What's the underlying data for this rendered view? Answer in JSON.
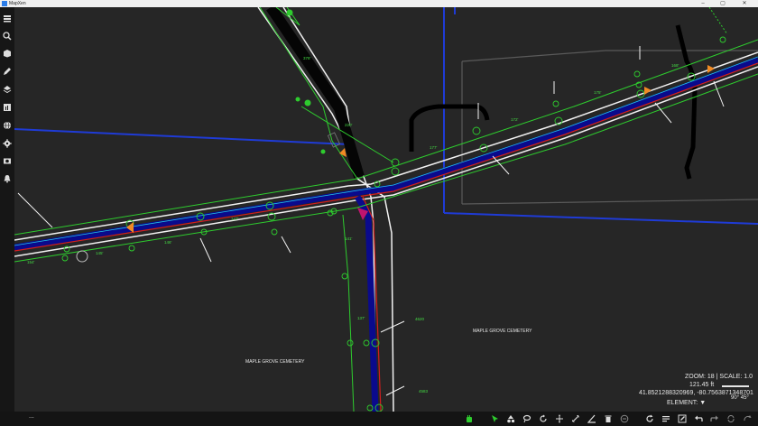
{
  "window": {
    "title": "MapXen",
    "minimize": "–",
    "maximize": "▢",
    "close": "✕"
  },
  "sidebar": {
    "items": [
      "layers",
      "search",
      "cube",
      "edit",
      "stack",
      "report",
      "globe",
      "settings",
      "camera",
      "bell"
    ]
  },
  "map": {
    "cemetery_label_1": "MAPLE GROVE CEMETERY",
    "cemetery_label_2": "MAPLE GROVE CEMETERY",
    "segment_labels": [
      "154'",
      "145'",
      "146'",
      "147'",
      "172'",
      "177'",
      "175'",
      "168'",
      "141'",
      "137'",
      "378'",
      "220'"
    ],
    "node_labels": [
      "4620",
      "4583"
    ]
  },
  "info": {
    "zoom_label": "ZOOM:",
    "zoom_value": "18",
    "scale_label": "| SCALE:",
    "scale_value": "1.0",
    "distance": "121.45 ft",
    "coords": "41.8521288320969, -80.7563871348701",
    "element_label": "ELEMENT:",
    "element_value": "▼",
    "angle_1": "90°",
    "angle_2": "45°"
  },
  "statusbar": {
    "text": "..."
  }
}
